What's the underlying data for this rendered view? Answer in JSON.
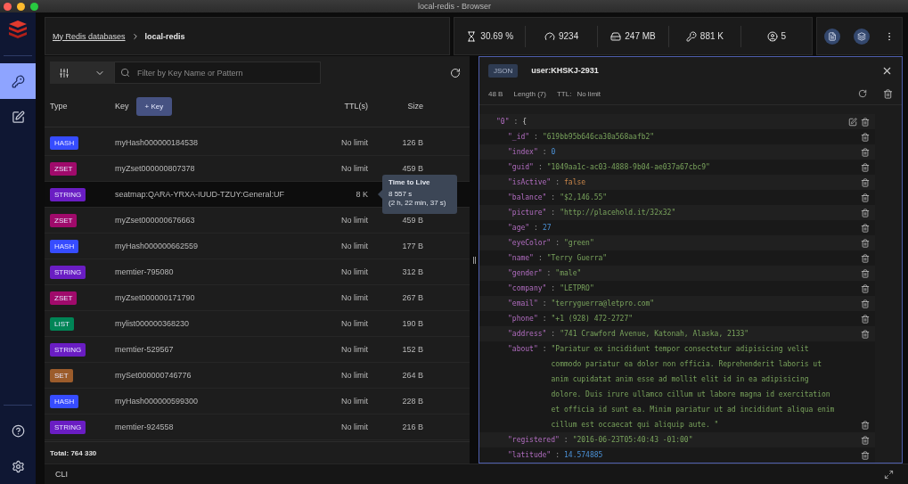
{
  "window": {
    "title": "local-redis - Browser"
  },
  "sidebar": {
    "items": [
      {
        "kind": "browser",
        "selected": true
      },
      {
        "kind": "workbench",
        "selected": false
      }
    ]
  },
  "breadcrumb": {
    "parent": "My Redis databases",
    "current": "local-redis"
  },
  "stats": [
    {
      "kind": "cpu",
      "value": "30.69 %"
    },
    {
      "kind": "ops",
      "value": "9234"
    },
    {
      "kind": "memory",
      "value": "247 MB"
    },
    {
      "kind": "keys",
      "value": "881 K"
    },
    {
      "kind": "clients",
      "value": "5"
    }
  ],
  "filter": {
    "placeholder": "Filter by Key Name or Pattern"
  },
  "key_table": {
    "columns": [
      "Type",
      "Key",
      "TTL(s)",
      "Size"
    ],
    "add_key_button": "+ Key",
    "rows": [
      {
        "type": "HASH",
        "color": "#364cff",
        "key": "myHash000000184538",
        "ttl": "No limit",
        "size": "126 B",
        "selected": false
      },
      {
        "type": "ZSET",
        "color": "#a00a6b",
        "key": "myZset000000807378",
        "ttl": "No limit",
        "size": "459 B",
        "selected": false
      },
      {
        "type": "STRING",
        "color": "#6a1dc3",
        "key": "seatmap:QARA-YRXA-IUUD-TZUY:General:UF",
        "ttl": "8 K",
        "selected": true
      },
      {
        "type": "ZSET",
        "color": "#a00a6b",
        "key": "myZset000000676663",
        "ttl": "No limit",
        "size": "459 B",
        "selected": false
      },
      {
        "type": "HASH",
        "color": "#364cff",
        "key": "myHash000000662559",
        "ttl": "No limit",
        "size": "177 B",
        "selected": false
      },
      {
        "type": "STRING",
        "color": "#6a1dc3",
        "key": "memtier-795080",
        "ttl": "No limit",
        "size": "312 B",
        "selected": false
      },
      {
        "type": "ZSET",
        "color": "#a00a6b",
        "key": "myZset000000171790",
        "ttl": "No limit",
        "size": "267 B",
        "selected": false
      },
      {
        "type": "LIST",
        "color": "#008556",
        "key": "mylist000000368230",
        "ttl": "No limit",
        "size": "190 B",
        "selected": false
      },
      {
        "type": "STRING",
        "color": "#6a1dc3",
        "key": "memtier-529567",
        "ttl": "No limit",
        "size": "152 B",
        "selected": false
      },
      {
        "type": "SET",
        "color": "#9c5c2b",
        "key": "mySet000000746776",
        "ttl": "No limit",
        "size": "264 B",
        "selected": false
      },
      {
        "type": "HASH",
        "color": "#364cff",
        "key": "myHash000000599300",
        "ttl": "No limit",
        "size": "228 B",
        "selected": false
      },
      {
        "type": "STRING",
        "color": "#6a1dc3",
        "key": "memtier-924558",
        "ttl": "No limit",
        "size": "216 B",
        "selected": false
      }
    ],
    "tooltip": {
      "title": "Time to Live",
      "seconds": "8 557 s",
      "duration": "(2 h, 22 min, 37 s)"
    },
    "total": "Total: 764 330"
  },
  "detail": {
    "type_badge": "JSON",
    "key": "user:KHSKJ-2931",
    "size": "48 B",
    "length": "Length (7)",
    "ttl_label": "TTL:",
    "ttl": "No limit",
    "lines": [
      {
        "key": "\"0\"",
        "sep": ":",
        "value": "{",
        "kind": "open"
      },
      {
        "key": "\"_id\"",
        "sep": ":",
        "value": "\"619bb95b646ca30a568aafb2\"",
        "kind": "string"
      },
      {
        "key": "\"index\"",
        "sep": ":",
        "value": "0",
        "kind": "number"
      },
      {
        "key": "\"guid\"",
        "sep": ":",
        "value": "\"1049aa1c-ac03-4888-9b04-ae037a67cbc9\"",
        "kind": "string"
      },
      {
        "key": "\"isActive\"",
        "sep": ":",
        "value": "false",
        "kind": "boolean"
      },
      {
        "key": "\"balance\"",
        "sep": ":",
        "value": "\"$2,146.55\"",
        "kind": "string"
      },
      {
        "key": "\"picture\"",
        "sep": ":",
        "value": "\"http://placehold.it/32x32\"",
        "kind": "string"
      },
      {
        "key": "\"age\"",
        "sep": ":",
        "value": "27",
        "kind": "number"
      },
      {
        "key": "\"eyeColor\"",
        "sep": ":",
        "value": "\"green\"",
        "kind": "string"
      },
      {
        "key": "\"name\"",
        "sep": ":",
        "value": "\"Terry Guerra\"",
        "kind": "string"
      },
      {
        "key": "\"gender\"",
        "sep": ":",
        "value": "\"male\"",
        "kind": "string"
      },
      {
        "key": "\"company\"",
        "sep": ":",
        "value": "\"LETPRO\"",
        "kind": "string"
      },
      {
        "key": "\"email\"",
        "sep": ":",
        "value": "\"terryguerra@letpro.com\"",
        "kind": "string"
      },
      {
        "key": "\"phone\"",
        "sep": ":",
        "value": "\"+1 (928) 472-2727\"",
        "kind": "string"
      },
      {
        "key": "\"address\"",
        "sep": ":",
        "value": "\"741 Crawford Avenue, Katonah, Alaska, 2133\"",
        "kind": "string"
      },
      {
        "key": "\"about\"",
        "sep": ":",
        "value": "\"Pariatur ex incididunt tempor consectetur adipisicing velit commodo pariatur ea dolor non officia. Reprehenderit laboris ut anim cupidatat anim esse ad mollit elit id in ea adipisicing dolore. Duis irure ullamco cillum ut labore magna id exercitation et officia id sunt ea. Minim pariatur ut ad incididunt aliqua enim cillum est occaecat qui aliquip aute. \"",
        "kind": "string"
      },
      {
        "key": "\"registered\"",
        "sep": ":",
        "value": "\"2016-06-23T05:40:43 -01:00\"",
        "kind": "string"
      },
      {
        "key": "\"latitude\"",
        "sep": ":",
        "value": "14.574885",
        "kind": "number"
      }
    ]
  },
  "cli": {
    "label": "CLI"
  }
}
